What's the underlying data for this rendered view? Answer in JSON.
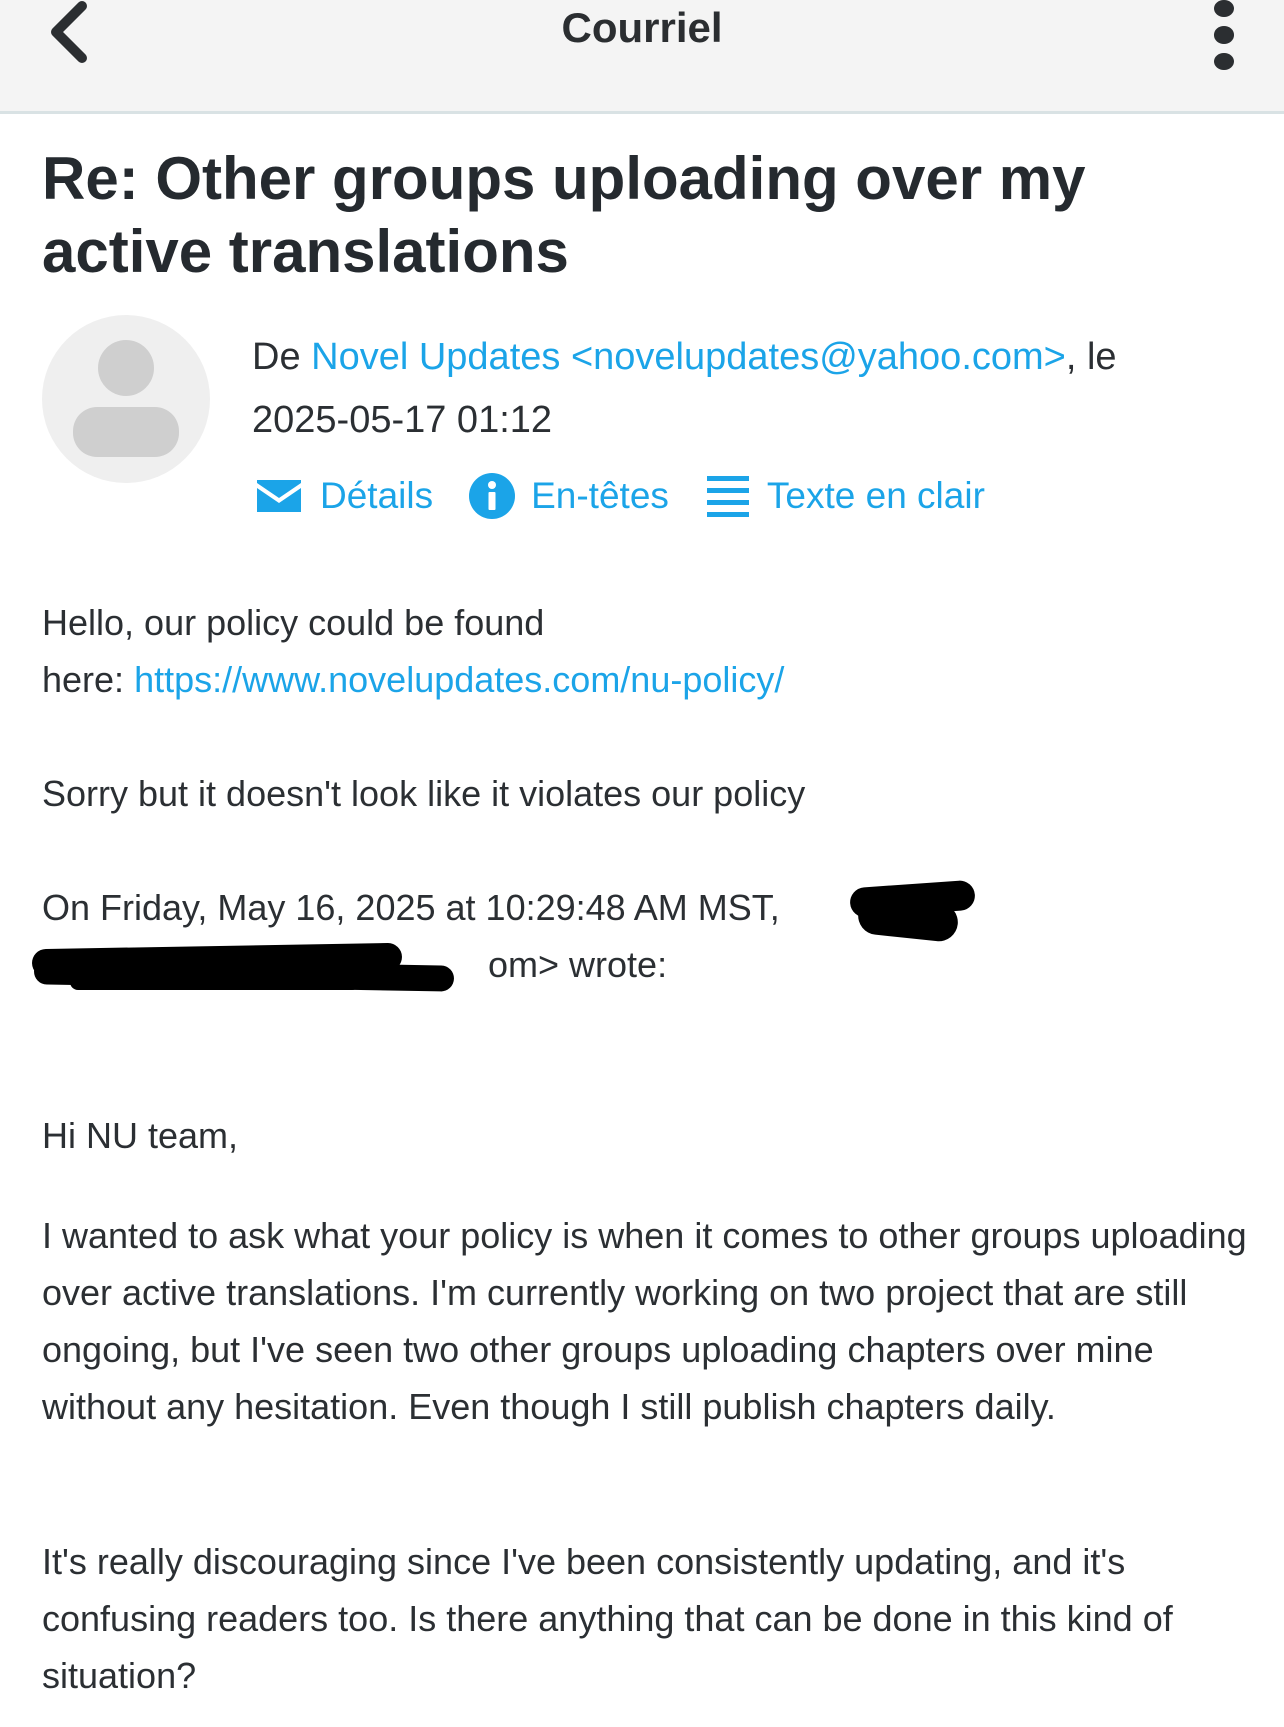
{
  "header": {
    "title": "Courriel",
    "back_icon": "chevron-left-icon",
    "menu_icon": "more-vertical-icon"
  },
  "email": {
    "subject": "Re: Other groups uploading over my active translations",
    "from_prefix": "De ",
    "sender": "Novel Updates <novelupdates@yahoo.com>",
    "date_prefix": ", le ",
    "date": "2025-05-17 01:12",
    "actions": [
      {
        "label": "Détails",
        "icon": "envelope-icon"
      },
      {
        "label": "En-têtes",
        "icon": "info-icon"
      },
      {
        "label": "Texte en clair",
        "icon": "list-lines-icon"
      }
    ]
  },
  "body": {
    "reply_line1": "Hello, our policy could be found",
    "reply_line2_prefix": "here: ",
    "policy_link": "https://www.novelupdates.com/nu-policy/",
    "reply_para2": "Sorry but it doesn't look like it violates our policy",
    "quote_header_line1": "On Friday, May 16, 2025 at 10:29:48 AM MST,",
    "quote_header_line2_suffix": "om> wrote:",
    "greeting": "Hi NU team,",
    "para1": "I wanted to ask what your policy is when it comes to other groups uploading over active translations. I'm currently working on two project that are still ongoing, but I've seen two other groups uploading chapters over mine without any hesitation. Even though I still publish chapters daily.",
    "para2": "It's really discouraging since I've been consistently updating, and it's confusing readers too. Is there anything that can be done in this kind of situation?"
  },
  "colors": {
    "link": "#1ba4e8",
    "topbar": "#f4f4f4",
    "text": "#2b2f33"
  }
}
